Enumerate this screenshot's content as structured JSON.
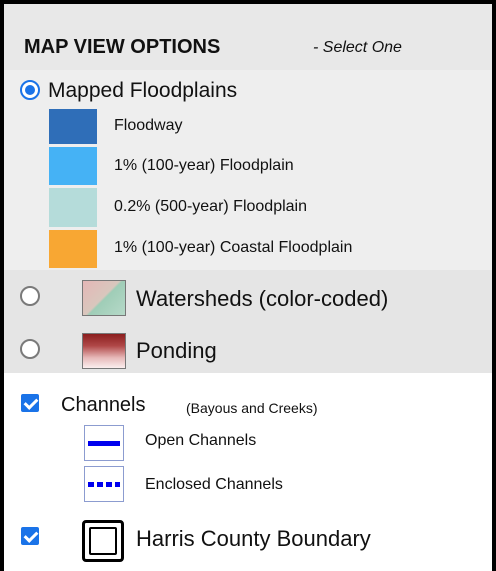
{
  "header": {
    "title": "MAP VIEW OPTIONS",
    "subtitle": "- Select One"
  },
  "floodplains": {
    "label": "Mapped Floodplains",
    "selected": true,
    "legend": [
      {
        "label": "Floodway",
        "color": "#2f6eb8"
      },
      {
        "label": "1% (100-year) Floodplain",
        "color": "#45b2f5"
      },
      {
        "label": "0.2% (500-year) Floodplain",
        "color": "#b5dcda"
      },
      {
        "label": "1% (100-year) Coastal Floodplain",
        "color": "#f8a733"
      }
    ]
  },
  "watersheds": {
    "label": "Watersheds (color-coded)",
    "selected": false
  },
  "ponding": {
    "label": "Ponding",
    "selected": false
  },
  "channels": {
    "label": "Channels",
    "note": "(Bayous and Creeks)",
    "checked": true,
    "legend": [
      {
        "label": "Open Channels",
        "icon": "solid-blue-line-icon"
      },
      {
        "label": "Enclosed Channels",
        "icon": "dashed-blue-line-icon"
      }
    ]
  },
  "boundary": {
    "label": "Harris County Boundary",
    "checked": true,
    "icon": "county-boundary-icon"
  }
}
